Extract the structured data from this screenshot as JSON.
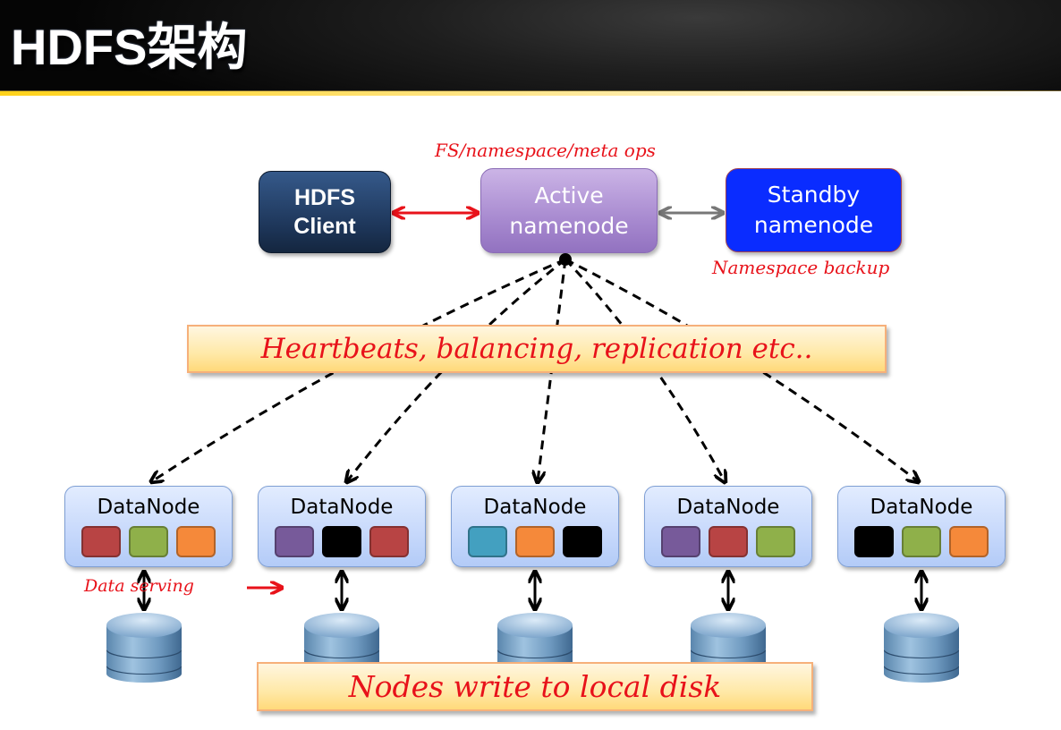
{
  "header": {
    "title": "HDFS架构"
  },
  "nodes": {
    "client": {
      "line1": "HDFS",
      "line2": "Client"
    },
    "active": {
      "line1": "Active",
      "line2": "namenode"
    },
    "standby": {
      "line1": "Standby",
      "line2": "namenode"
    }
  },
  "annotations": {
    "fs_ops": "FS/namespace/meta ops",
    "namespace_backup": "Namespace backup",
    "heartbeats": "Heartbeats, balancing, replication etc..",
    "data_serving": "Data serving",
    "local_disk": "Nodes write to local disk"
  },
  "colors": {
    "annotation_red": "#e8121a",
    "client_navy": "#1d3558",
    "active_purple": "#a88ad0",
    "standby_blue": "#0a2cff",
    "block_red": "#b84444",
    "block_green": "#8fb04a",
    "block_orange": "#f5893a",
    "block_purple": "#775a9a",
    "block_black": "#000000",
    "block_teal": "#43a0c0"
  },
  "datanodes": [
    {
      "label": "DataNode",
      "blocks": [
        "red",
        "green",
        "orange"
      ]
    },
    {
      "label": "DataNode",
      "blocks": [
        "purple",
        "black",
        "red"
      ]
    },
    {
      "label": "DataNode",
      "blocks": [
        "teal",
        "orange",
        "black"
      ]
    },
    {
      "label": "DataNode",
      "blocks": [
        "purple",
        "red",
        "green"
      ]
    },
    {
      "label": "DataNode",
      "blocks": [
        "black",
        "green",
        "orange"
      ]
    }
  ]
}
